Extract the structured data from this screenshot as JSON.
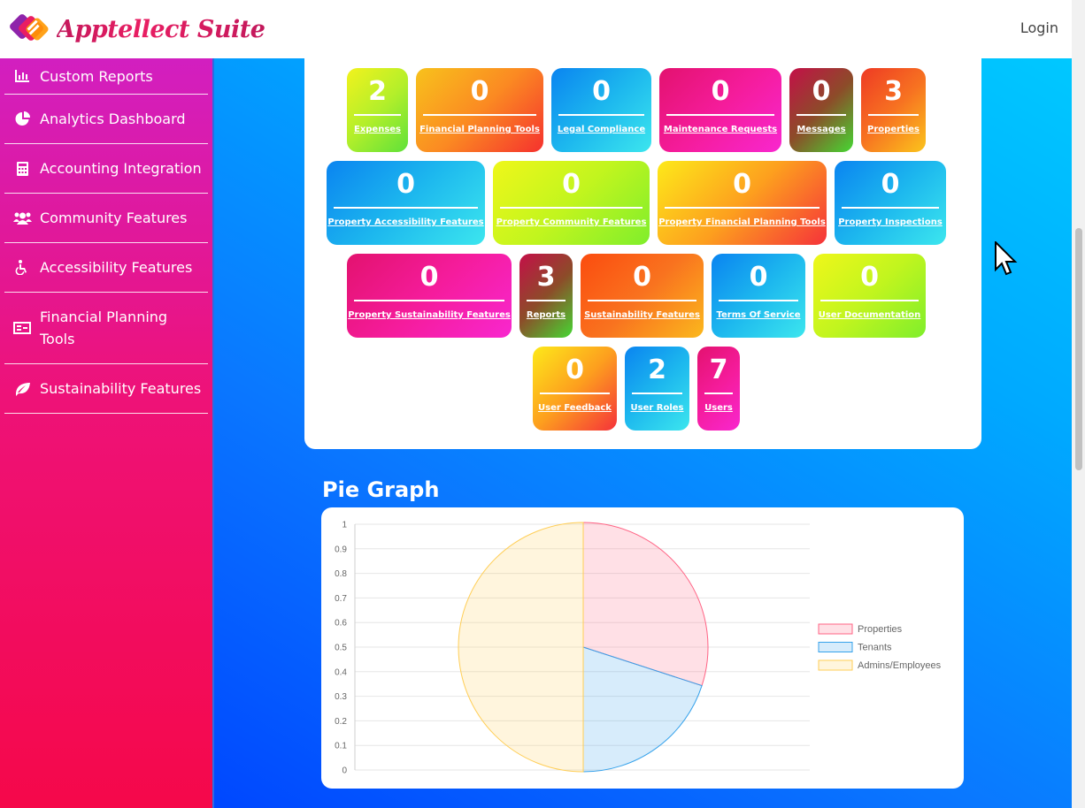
{
  "app": {
    "title": "Apptellect Suite",
    "login": "Login"
  },
  "sidebar": {
    "items": [
      {
        "label": "Custom Reports",
        "icon": "bar-chart-icon"
      },
      {
        "label": "Analytics Dashboard",
        "icon": "pie-chart-icon"
      },
      {
        "label": "Accounting Integration",
        "icon": "calculator-icon"
      },
      {
        "label": "Community Features",
        "icon": "users-icon"
      },
      {
        "label": "Accessibility Features",
        "icon": "wheelchair-icon"
      },
      {
        "label": "Financial Planning Tools",
        "icon": "money-bill-icon"
      },
      {
        "label": "Sustainability Features",
        "icon": "leaf-icon"
      }
    ]
  },
  "tiles": {
    "row1": [
      {
        "num": "2",
        "label": "Expenses",
        "color": "green"
      },
      {
        "num": "0",
        "label": "Financial Planning Tools",
        "color": "orange"
      },
      {
        "num": "0",
        "label": "Legal Compliance",
        "color": "blue"
      },
      {
        "num": "0",
        "label": "Maintenance Requests",
        "color": "pink"
      },
      {
        "num": "0",
        "label": "Messages",
        "color": "red"
      },
      {
        "num": "3",
        "label": "Properties",
        "color": "orange2"
      }
    ],
    "row2": [
      {
        "num": "0",
        "label": "Property Accessibility Features",
        "color": "blue"
      },
      {
        "num": "0",
        "label": "Property Community Features",
        "color": "lime"
      },
      {
        "num": "0",
        "label": "Property Financial Planning Tools",
        "color": "yellow"
      },
      {
        "num": "0",
        "label": "Property Inspections",
        "color": "blue"
      }
    ],
    "row3": [
      {
        "num": "0",
        "label": "Property Sustainability Features",
        "color": "pink"
      },
      {
        "num": "3",
        "label": "Reports",
        "color": "red"
      },
      {
        "num": "0",
        "label": "Sustainability Features",
        "color": "red2"
      },
      {
        "num": "0",
        "label": "Terms Of Service",
        "color": "blue"
      },
      {
        "num": "0",
        "label": "User Documentation",
        "color": "lime"
      }
    ],
    "row4": [
      {
        "num": "0",
        "label": "User Feedback",
        "color": "yellow"
      },
      {
        "num": "2",
        "label": "User Roles",
        "color": "blue"
      },
      {
        "num": "7",
        "label": "Users",
        "color": "pink"
      }
    ]
  },
  "pie": {
    "title": "Pie Graph"
  },
  "chart_data": {
    "type": "pie",
    "title": "",
    "labels": [
      "Properties",
      "Tenants",
      "Admins/Employees"
    ],
    "values": [
      3,
      2,
      5
    ],
    "colors": [
      "#ff6384",
      "#36a2eb",
      "#ffce56"
    ],
    "y_ticks": [
      "0",
      "0.1",
      "0.2",
      "0.3",
      "0.4",
      "0.5",
      "0.6",
      "0.7",
      "0.8",
      "0.9",
      "1"
    ],
    "ylim": [
      0,
      1
    ],
    "legend_position": "right",
    "grid": true
  }
}
